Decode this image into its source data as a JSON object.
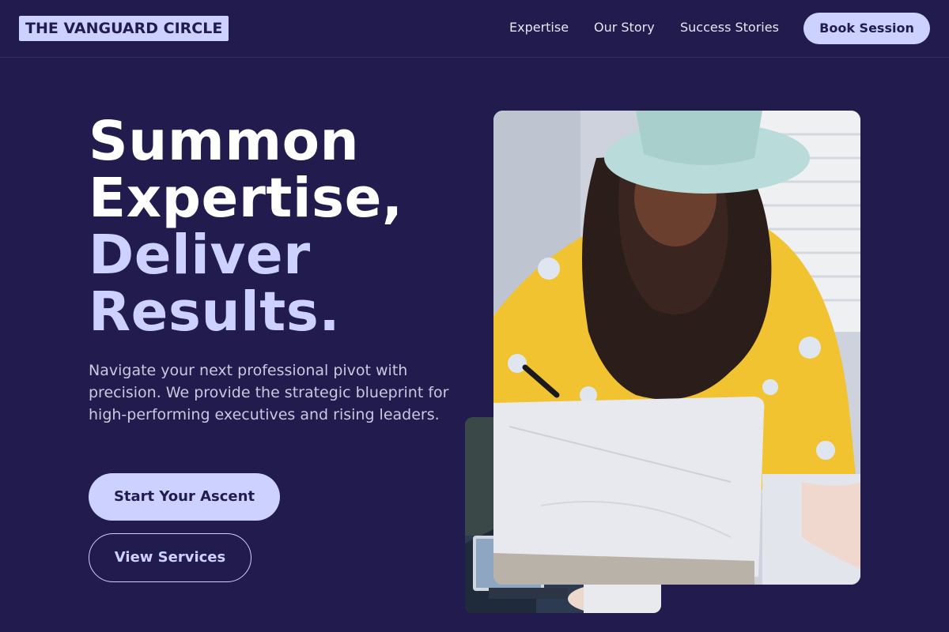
{
  "header": {
    "logo": "THE VANGUARD CIRCLE",
    "nav": {
      "expertise": "Expertise",
      "story": "Our Story",
      "success": "Success Stories"
    },
    "cta": "Book Session"
  },
  "hero": {
    "title": {
      "line1": "Summon",
      "line2": "Expertise,",
      "line3": "Deliver",
      "line4": "Results."
    },
    "description": "Navigate your next professional pivot with precision. We provide the strategic blueprint for high-performing executives and rising leaders.",
    "primary_button": "Start Your Ascent",
    "secondary_button": "View Services"
  },
  "colors": {
    "background": "#211c4d",
    "accent": "#cdd1ff",
    "text": "#ffffff",
    "muted_text": "#c9c8e0"
  }
}
